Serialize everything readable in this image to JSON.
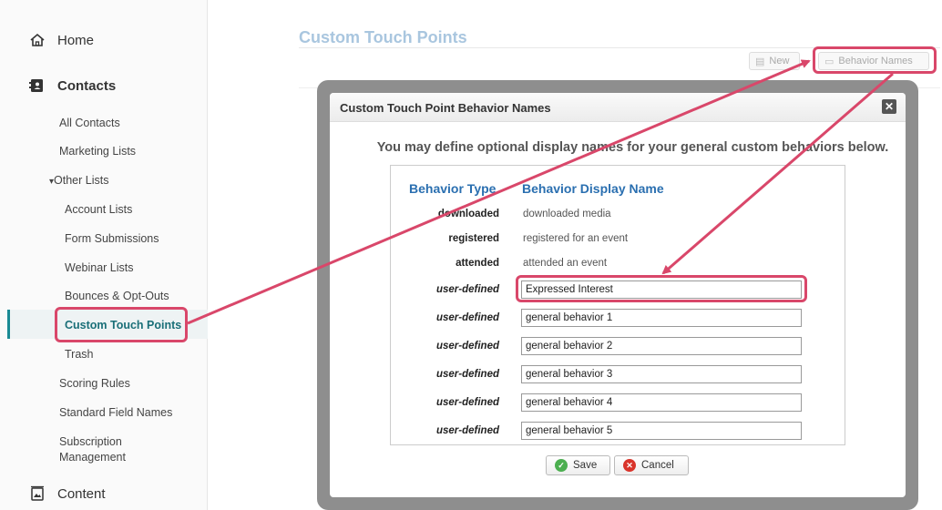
{
  "sidebar": {
    "home": {
      "label": "Home",
      "icon": "home-icon"
    },
    "contacts": {
      "label": "Contacts",
      "icon": "contacts-book-icon"
    },
    "items": [
      {
        "label": "All Contacts"
      },
      {
        "label": "Marketing Lists"
      },
      {
        "label": "Other Lists",
        "arrow": "▾"
      },
      {
        "label": "Account Lists"
      },
      {
        "label": "Form Submissions"
      },
      {
        "label": "Webinar Lists"
      },
      {
        "label": "Bounces & Opt-Outs"
      },
      {
        "label": "Custom Touch Points",
        "active": true
      },
      {
        "label": "Trash"
      },
      {
        "label": "Scoring Rules"
      },
      {
        "label": "Standard Field Names"
      },
      {
        "label": "Subscription",
        "label2": "Management"
      }
    ],
    "content": {
      "label": "Content",
      "icon": "content-icon"
    }
  },
  "main": {
    "title": "Custom Touch Points",
    "toolbar": {
      "new_label": "New",
      "behavior_names_label": "Behavior Names"
    }
  },
  "modal": {
    "title": "Custom Touch Point Behavior Names",
    "close_glyph": "✕",
    "instruction": "You may define optional display names for your general custom behaviors below.",
    "col_type": "Behavior Type",
    "col_name": "Behavior Display Name",
    "fixed_rows": [
      {
        "type": "downloaded",
        "name": "downloaded media"
      },
      {
        "type": "registered",
        "name": "registered for an event"
      },
      {
        "type": "attended",
        "name": "attended an event"
      }
    ],
    "user_rows": [
      {
        "type": "user-defined",
        "value": "Expressed Interest"
      },
      {
        "type": "user-defined",
        "value": "general behavior 1"
      },
      {
        "type": "user-defined",
        "value": "general behavior 2"
      },
      {
        "type": "user-defined",
        "value": "general behavior 3"
      },
      {
        "type": "user-defined",
        "value": "general behavior 4"
      },
      {
        "type": "user-defined",
        "value": "general behavior 5"
      }
    ],
    "save_label": "Save",
    "cancel_label": "Cancel"
  },
  "colors": {
    "annotation": "#d9476a",
    "header_blue": "#2a6fb0",
    "active_teal": "#1a6f78"
  }
}
